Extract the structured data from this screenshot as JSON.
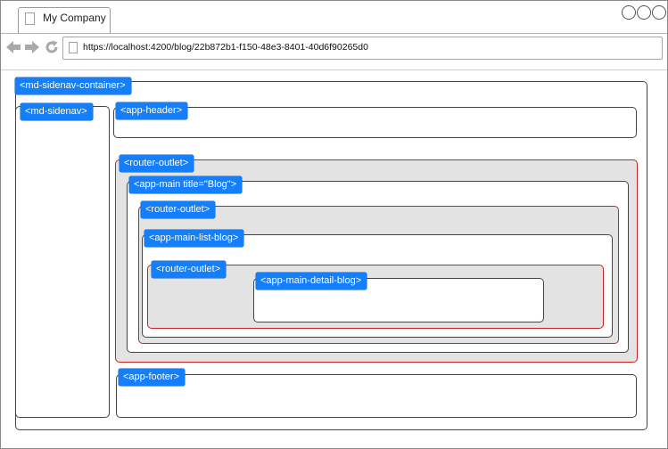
{
  "browser": {
    "tab_title": "My Company",
    "url": "https://localhost:4200/blog/22b872b1-f150-48e3-8401-40d6f90265d0",
    "window_controls": [
      "circle-icon",
      "circle-icon",
      "circle-icon"
    ],
    "nav_icons": [
      "back-arrow-icon",
      "forward-arrow-icon",
      "reload-icon"
    ]
  },
  "components": {
    "sidenav_container": "<md-sidenav-container>",
    "sidenav": "<md-sidenav>",
    "app_header": "<app-header>",
    "router_outlet_1": "<router-outlet>",
    "app_main": "<app-main title=\"Blog\">",
    "router_outlet_2": "<router-outlet>",
    "app_main_list_blog": "<app-main-list-blog>",
    "router_outlet_3": "<router-outlet>",
    "app_main_detail_blog": "<app-main-detail-blog>",
    "app_footer": "<app-footer>"
  },
  "colors": {
    "tag_background": "#157efb",
    "outlet_border": "#cc1f1f",
    "outlet_fill": "#e3e3e3"
  }
}
